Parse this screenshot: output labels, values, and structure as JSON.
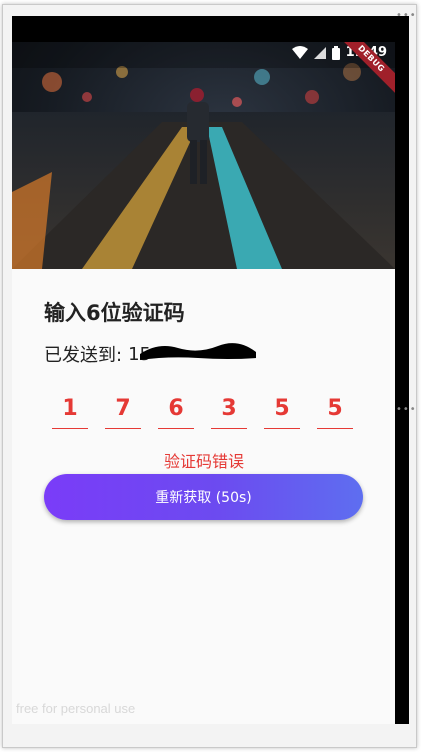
{
  "status_bar": {
    "time": "11:49"
  },
  "debug_banner": "DEBUG",
  "page": {
    "title": "输入6位验证码",
    "sent_to_label": "已发送到:",
    "phone_visible_prefix": "15"
  },
  "code_digits": [
    "1",
    "7",
    "6",
    "3",
    "5",
    "5"
  ],
  "error_message": "验证码错误",
  "resend_button_label": "重新获取 (50s)",
  "watermark": "free for personal use",
  "colors": {
    "error_red": "#e53935",
    "button_gradient_start": "#7a3cf8",
    "button_gradient_end": "#5e6ef0"
  }
}
